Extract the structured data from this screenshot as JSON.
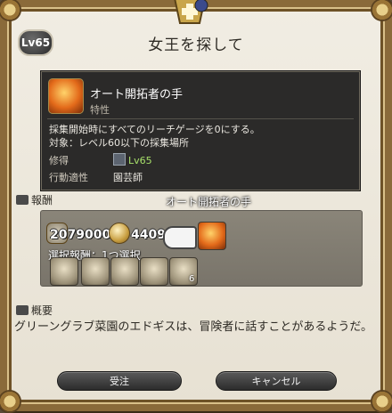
{
  "header": {
    "level": "Lv65",
    "title": "女王を探して"
  },
  "tooltip": {
    "name": "オート開拓者の手",
    "type": "特性",
    "description": [
      "採集開始時にすべてのリーチゲージを0にする。",
      "対象：レベル60以下の採集場所"
    ],
    "acquired_label": "修得",
    "acquired_value": "Lv65",
    "class_label": "行動適性",
    "class_value": "園芸師"
  },
  "rewards": {
    "label": "報酬",
    "hover_name": "オート開拓者の手",
    "exp": "2079000",
    "gil": "4409",
    "selection_text": "選択報酬：1つ選択",
    "last_item_count": "6"
  },
  "summary": {
    "label": "概要",
    "text": "グリーングラブ菜園のエドギスは、冒険者に話すことがあるようだ。"
  },
  "buttons": {
    "accept": "受注",
    "cancel": "キャンセル"
  },
  "icons": [
    "level-badge-icon",
    "trait-icon",
    "exp-icon",
    "gil-icon",
    "pointer-hand-icon",
    "reward-item-icon"
  ]
}
